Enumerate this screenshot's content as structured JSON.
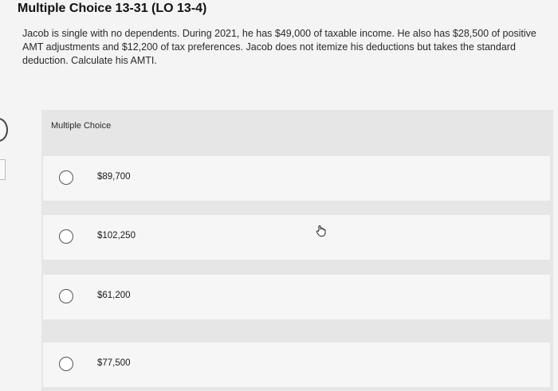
{
  "header": {
    "title": "Multiple Choice 13-31 (LO 13-4)"
  },
  "question": {
    "text": "Jacob is single with no dependents. During 2021, he has $49,000 of taxable income. He also has $28,500 of positive AMT adjustments and $12,200 of tax preferences. Jacob does not itemize his deductions but takes the standard deduction. Calculate his AMTI."
  },
  "choices": {
    "header": "Multiple Choice",
    "options": [
      {
        "label": "$89,700"
      },
      {
        "label": "$102,250"
      },
      {
        "label": "$61,200"
      },
      {
        "label": "$77,500"
      }
    ]
  }
}
